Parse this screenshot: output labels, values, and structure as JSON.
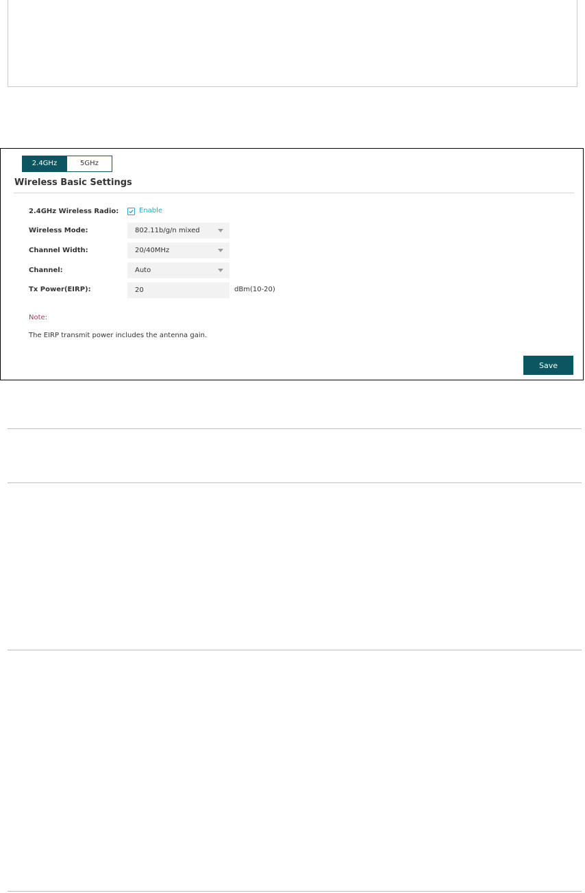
{
  "tabs": [
    {
      "label": "2.4GHz",
      "active": true
    },
    {
      "label": "5GHz",
      "active": false
    }
  ],
  "section_title": "Wireless Basic Settings",
  "fields": {
    "radio_label": "2.4GHz Wireless Radio:",
    "radio_checkbox_label": "Enable",
    "radio_enabled": true,
    "mode_label": "Wireless Mode:",
    "mode_value": "802.11b/g/n mixed",
    "width_label": "Channel Width:",
    "width_value": "20/40MHz",
    "channel_label": "Channel:",
    "channel_value": "Auto",
    "power_label": "Tx Power(EIRP):",
    "power_value": "20",
    "power_unit": "dBm(10-20)"
  },
  "note": {
    "label": "Note:",
    "text": "The EIRP transmit power includes the antenna gain."
  },
  "save_label": "Save",
  "icons": {
    "checkbox": "checkmark-icon",
    "dropdown": "caret-down-icon"
  },
  "colors": {
    "accent": "#0b5660",
    "link": "#2aa6c4",
    "note": "#a23a55",
    "field_bg": "#f2f2f2"
  }
}
